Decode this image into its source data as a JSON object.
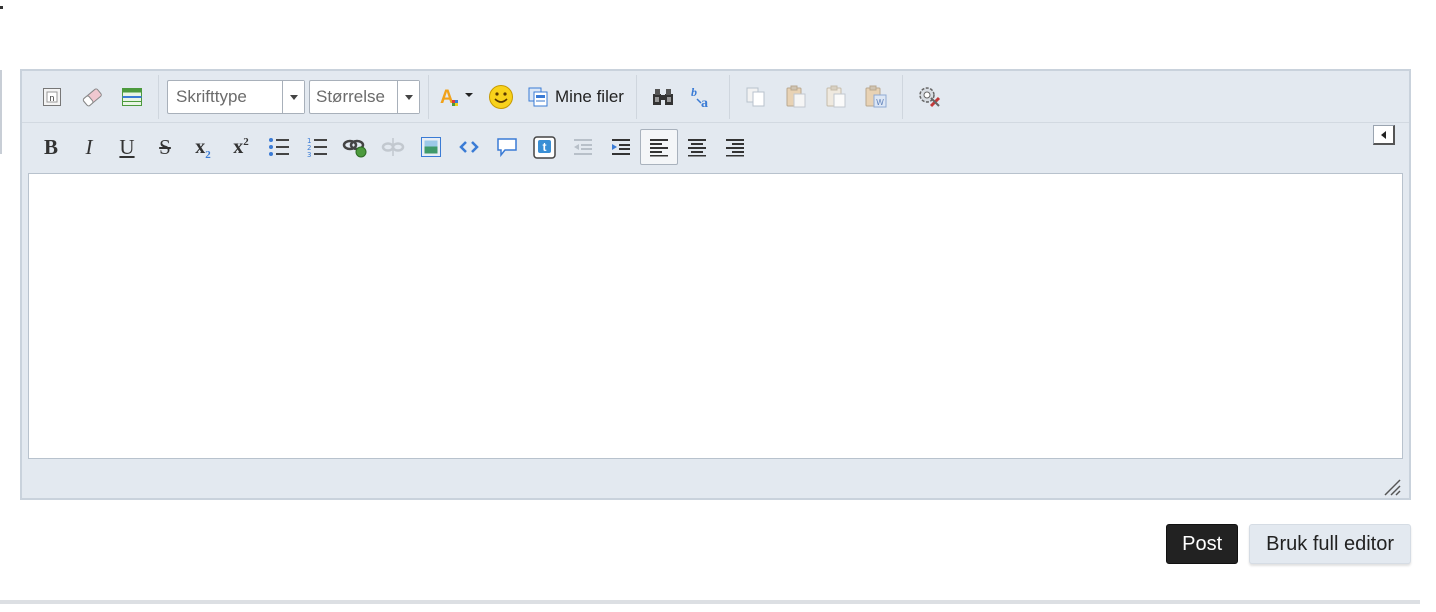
{
  "toolbar": {
    "font_combo": {
      "placeholder": "Skrifttype"
    },
    "size_combo": {
      "placeholder": "Størrelse"
    },
    "my_files_label": "Mine filer",
    "bold_glyph": "B",
    "italic_glyph": "I",
    "underline_glyph": "U",
    "strike_glyph": "S",
    "subscript_glyph": "x",
    "subscript_small": "2",
    "superscript_glyph": "x",
    "superscript_small": "2"
  },
  "actions": {
    "post_label": "Post",
    "full_editor_label": "Bruk full editor"
  },
  "colors": {
    "editor_bg": "#e3e9f0",
    "post_button_bg": "#222222",
    "accent_blue": "#3a7bd5"
  },
  "icons": {
    "row1": [
      "source-icon",
      "eraser-icon",
      "table-icon",
      "text-color-icon",
      "smiley-icon",
      "files-icon",
      "find-icon",
      "replace-icon",
      "copy-icon",
      "paste-icon",
      "paste-text-icon",
      "paste-word-icon",
      "settings-icon"
    ],
    "row2": [
      "bold-icon",
      "italic-icon",
      "underline-icon",
      "strikethrough-icon",
      "subscript-icon",
      "superscript-icon",
      "bullet-list-icon",
      "numbered-list-icon",
      "link-icon",
      "unlink-icon",
      "image-icon",
      "code-icon",
      "quote-icon",
      "twitter-icon",
      "outdent-icon",
      "indent-icon",
      "align-left-icon",
      "align-center-icon",
      "align-right-icon"
    ]
  }
}
